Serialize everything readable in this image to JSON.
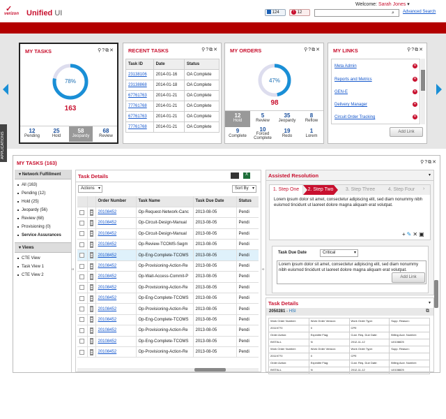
{
  "header": {
    "logo_text": "verizon",
    "app_title_1": "Unified",
    "app_title_2": "UI",
    "badge_count_1": "124",
    "badge_count_2": "12",
    "welcome_label": "Welcome:",
    "user_name": "Sarah Jones",
    "advanced_search": "Advanced Search"
  },
  "my_tasks": {
    "title": "MY TASKS",
    "percent": "78%",
    "percent_value": 0.78,
    "total": "163",
    "stats": [
      {
        "value": "12",
        "label": "Pending"
      },
      {
        "value": "25",
        "label": "Hold"
      },
      {
        "value": "58",
        "label": "Jeopardy"
      },
      {
        "value": "68",
        "label": "Review"
      }
    ]
  },
  "recent_tasks": {
    "title": "RECENT TASKS",
    "headers": [
      "Task ID",
      "Date",
      "Status"
    ],
    "rows": [
      [
        "23138106",
        "2014-01-16",
        "OA Complete"
      ],
      [
        "23138868",
        "2014-01-18",
        "OA Complete"
      ],
      [
        "67761763",
        "2014-01-21",
        "OA Complete"
      ],
      [
        "77761768",
        "2014-01-21",
        "OA Complete"
      ],
      [
        "67761763",
        "2014-01-21",
        "OA Complete"
      ],
      [
        "77761768",
        "2014-01-21",
        "OA Complete"
      ]
    ]
  },
  "my_orders": {
    "title": "MY ORDERS",
    "percent": "47%",
    "percent_value": 0.47,
    "total": "98",
    "stats": [
      {
        "value": "12",
        "label": "Hold"
      },
      {
        "value": "5",
        "label": "Review"
      },
      {
        "value": "35",
        "label": "Jeopardy"
      },
      {
        "value": "8",
        "label": "Reflow"
      },
      {
        "value": "9",
        "label": "Complete"
      },
      {
        "value": "10",
        "label": "Forced Complete"
      },
      {
        "value": "19",
        "label": "Redo"
      },
      {
        "value": "1",
        "label": "Lorem"
      }
    ]
  },
  "my_links": {
    "title": "MY LINKS",
    "items": [
      "Meta Admin",
      "Reports and Metrics",
      "GEN-E",
      "Delivery Manager",
      "Circuit Order Tracking"
    ],
    "add_button": "Add Link"
  },
  "applications_tab": "APPLICATIONS",
  "bottom": {
    "title": "MY TASKS (163)",
    "sidebar": {
      "header1": "Network Fulfillment",
      "items1": [
        "All (163)",
        "Pending (12)",
        "Hold (25)",
        "Jeopardy (56)",
        "Review (68)",
        "Provisioning (0)",
        "Service Assurances"
      ],
      "header2": "Views",
      "items2": [
        "CTE View",
        "Task View 1",
        "CTE View 2"
      ]
    },
    "task_details": {
      "title": "Task Details",
      "actions": "Actions",
      "sort_by": "Sort By",
      "headers": [
        "Order Number",
        "Task Name",
        "Task Due Date",
        "Status"
      ],
      "rows": [
        [
          "20108452",
          "Op-Request-Network-Canc",
          "2013-08-05",
          "Pendi"
        ],
        [
          "20108452",
          "Op-Circuit-Design-Manual",
          "2013-08-05",
          "Pendi"
        ],
        [
          "20108452",
          "Op-Circuit-Design-Manual",
          "2013-08-05",
          "Pendi"
        ],
        [
          "20108452",
          "Op-Review-TCOMS-Segm",
          "2013-08-05",
          "Pendi"
        ],
        [
          "20108452",
          "Op-Eng-Complete-TCOMS",
          "2013-08-05",
          "Pendi"
        ],
        [
          "20108452",
          "Op-Provisioning-Action-Re",
          "2013-08-05",
          "Pendi"
        ],
        [
          "20108452",
          "Op-Wait-Access-Commit-P",
          "2013-08-05",
          "Pendi"
        ],
        [
          "20108452",
          "Op-Provisioning-Action-Re",
          "2013-08-05",
          "Pendi"
        ],
        [
          "20108452",
          "Op-Eng-Complete-TCOMS",
          "2013-08-05",
          "Pendi"
        ],
        [
          "20108452",
          "Op-Provisioning-Action-Re",
          "2013-08-05",
          "Pendi"
        ],
        [
          "20108452",
          "Op-Eng-Complete-TCOMS",
          "2013-08-05",
          "Pendi"
        ],
        [
          "20108452",
          "Op-Provisioning-Action-Re",
          "2013-08-05",
          "Pendi"
        ],
        [
          "20108452",
          "Op-Eng-Complete-TCOMS",
          "2013-08-05",
          "Pendi"
        ],
        [
          "20108452",
          "Op-Provisioning-Action-Re",
          "2013-08-05",
          "Pendi"
        ]
      ]
    },
    "assisted": {
      "title": "Assisted Resolution",
      "steps": [
        "1. Step One",
        "2. Step Two",
        "3. Step Three",
        "4. Step Four"
      ],
      "text1": "Lorem ipsum dolor sit amet, consectetur adipiscing elit, sed diam nonummy nibh euismod tincidunt ut laoreet dolore magna aliquam erat volutpat.",
      "due_label": "Task Due Date",
      "due_value": "Critical",
      "text2": "Lorem ipsum dolor sit amet, consectetur adipiscing elit, sed diam nonummy nibh euismod tincidunt ut laoreet dolore magna aliquam erat volutpat.",
      "add_link": "Add Link"
    },
    "task_details2": {
      "title": "Task Details",
      "order": "2050281",
      "order_type": "HSI",
      "grid": [
        [
          "Work Order Number:",
          "Work Order Version:",
          "Work Order Type:",
          "Supp. Reason:"
        ],
        [
          "20119770",
          "0",
          "CPE",
          ""
        ],
        [
          "Order Action:",
          "Expedite Flag:",
          "Cust. Req. Due Date:",
          "Billing Acct. Number:"
        ],
        [
          "INSTALL",
          "N",
          "2012-11-12",
          "U0108825"
        ],
        [
          "Work Order Number:",
          "Work Order Version:",
          "Work Order Type:",
          "Supp. Reason:"
        ],
        [
          "20119770",
          "0",
          "CPE",
          ""
        ],
        [
          "Order Action:",
          "Expedite Flag:",
          "Cust. Req. Due Date:",
          "Billing Acct. Number:"
        ],
        [
          "INSTALL",
          "N",
          "2012-11-12",
          "U0108825"
        ]
      ]
    }
  }
}
